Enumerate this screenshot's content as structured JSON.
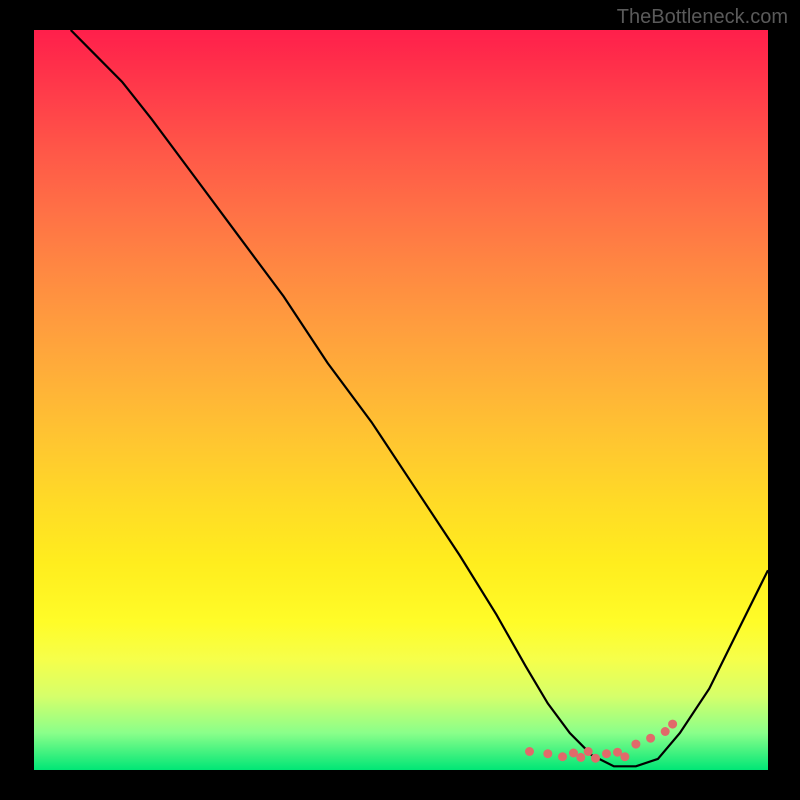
{
  "watermark": "TheBottleneck.com",
  "chart_data": {
    "type": "line",
    "title": "",
    "xlabel": "",
    "ylabel": "",
    "xlim": [
      0,
      100
    ],
    "ylim": [
      0,
      100
    ],
    "grid": false,
    "series": [
      {
        "name": "curve",
        "x": [
          5,
          8,
          12,
          16,
          22,
          28,
          34,
          40,
          46,
          52,
          58,
          63,
          67,
          70,
          73,
          76,
          79,
          82,
          85,
          88,
          92,
          96,
          100
        ],
        "y": [
          100,
          97,
          93,
          88,
          80,
          72,
          64,
          55,
          47,
          38,
          29,
          21,
          14,
          9,
          5,
          2,
          0.5,
          0.5,
          1.5,
          5,
          11,
          19,
          27
        ]
      }
    ],
    "marker_cluster": {
      "x": [
        67.5,
        70,
        72,
        73.5,
        74.5,
        75.5,
        76.5,
        78,
        79.5,
        80.5,
        82,
        84,
        86,
        87
      ],
      "y": [
        2.5,
        2.2,
        1.8,
        2.3,
        1.7,
        2.5,
        1.6,
        2.2,
        2.4,
        1.8,
        3.5,
        4.3,
        5.2,
        6.2
      ],
      "color": "#e16a6a",
      "size": 9
    },
    "background_gradient": {
      "top_color": "#ff1f4b",
      "bottom_color": "#00e676"
    }
  }
}
